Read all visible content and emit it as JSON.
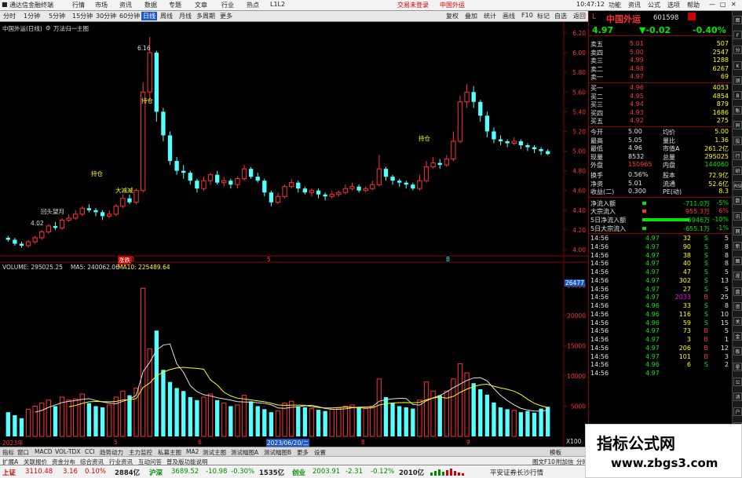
{
  "titlebar": {
    "app_name": "通达信金融终端",
    "menus": [
      "行情",
      "市场",
      "资讯",
      "数据",
      "专题",
      "文章",
      "行业",
      "热点",
      "L1L2"
    ],
    "alert1": "交易未登录",
    "alert2": "中国外运",
    "time": "10:47:12",
    "right_items": [
      "功能",
      "资讯",
      "公式",
      "选项",
      "帮助"
    ]
  },
  "toolbar": {
    "periods": [
      "分时",
      "1分钟",
      "5分钟",
      "15分钟",
      "30分钟",
      "60分钟",
      "日线",
      "周线",
      "月线",
      "多周期",
      "更多"
    ],
    "active_period": "日线",
    "right_buttons": [
      "复权",
      "叠加",
      "统计",
      "画线",
      "F10",
      "标记",
      "自选",
      "返回"
    ]
  },
  "chart": {
    "main_title": "中国外运(日线)",
    "main_indicator": "万法归一主图",
    "price_labels": [
      "6.20",
      "6.00",
      "5.80",
      "5.60",
      "5.40",
      "5.20",
      "5.00",
      "4.80",
      "4.60",
      "4.40",
      "4.20",
      "4.00"
    ],
    "annotations": {
      "high": "6.16",
      "low": "4.02",
      "hold1": "持仓",
      "hold2": "持仓",
      "hold3": "持仓",
      "big_hold": "大减减",
      "cautious": "回头望月"
    },
    "volume_title": "VOLUME: 295025.25",
    "ma5": "MA5: 240062.06",
    "ma10": "MA10: 225489.64",
    "volume_labels": [
      "25000",
      "20000",
      "15000",
      "10000",
      "5000"
    ],
    "vol_unit": "X100",
    "vol_marker": "26477",
    "date_label": "2023/06/20/二",
    "year_label": "2023年",
    "x_marks": [
      "5",
      "6",
      "7",
      "8",
      "9"
    ],
    "mid_marks": [
      "涨跌",
      "B",
      "B"
    ],
    "mid_labels": [
      "5",
      "8"
    ]
  },
  "chart_data": {
    "type": "candlestick",
    "title": "中国外运(日线)",
    "ylim": [
      4.0,
      6.2
    ],
    "volume_ylim": [
      0,
      27000
    ],
    "note": "Approximate daily candles read from chart",
    "candles": [
      [
        4.12,
        4.1,
        4.14,
        4.08
      ],
      [
        4.1,
        4.06,
        4.12,
        4.04
      ],
      [
        4.06,
        4.04,
        4.08,
        4.02
      ],
      [
        4.04,
        4.08,
        4.1,
        4.02
      ],
      [
        4.08,
        4.12,
        4.14,
        4.06
      ],
      [
        4.12,
        4.18,
        4.2,
        4.1
      ],
      [
        4.18,
        4.24,
        4.26,
        4.16
      ],
      [
        4.24,
        4.22,
        4.28,
        4.2
      ],
      [
        4.22,
        4.3,
        4.32,
        4.2
      ],
      [
        4.3,
        4.32,
        4.36,
        4.28
      ],
      [
        4.32,
        4.36,
        4.4,
        4.3
      ],
      [
        4.36,
        4.42,
        4.44,
        4.34
      ],
      [
        4.42,
        4.4,
        4.46,
        4.38
      ],
      [
        4.4,
        4.38,
        4.42,
        4.34
      ],
      [
        4.38,
        4.34,
        4.4,
        4.3
      ],
      [
        4.34,
        4.36,
        4.4,
        4.32
      ],
      [
        4.36,
        4.44,
        4.46,
        4.34
      ],
      [
        4.44,
        4.52,
        4.56,
        4.42
      ],
      [
        4.52,
        4.48,
        4.56,
        4.46
      ],
      [
        4.48,
        4.6,
        4.62,
        4.46
      ],
      [
        4.6,
        5.6,
        5.7,
        4.58
      ],
      [
        5.6,
        6.0,
        6.16,
        5.5
      ],
      [
        6.0,
        5.4,
        6.02,
        5.3
      ],
      [
        5.4,
        5.16,
        5.44,
        5.1
      ],
      [
        5.16,
        4.9,
        5.2,
        4.86
      ],
      [
        4.9,
        4.8,
        4.94,
        4.76
      ],
      [
        4.8,
        4.78,
        4.86,
        4.72
      ],
      [
        4.78,
        4.7,
        4.8,
        4.66
      ],
      [
        4.7,
        4.62,
        4.72,
        4.58
      ],
      [
        4.62,
        4.7,
        4.74,
        4.6
      ],
      [
        4.7,
        4.76,
        4.78,
        4.66
      ],
      [
        4.76,
        4.68,
        4.8,
        4.66
      ],
      [
        4.68,
        4.7,
        4.74,
        4.64
      ],
      [
        4.7,
        4.66,
        4.72,
        4.62
      ],
      [
        4.66,
        4.72,
        4.74,
        4.62
      ],
      [
        4.72,
        4.82,
        4.86,
        4.7
      ],
      [
        4.82,
        4.74,
        4.84,
        4.72
      ],
      [
        4.74,
        4.7,
        4.78,
        4.68
      ],
      [
        4.7,
        4.58,
        4.72,
        4.54
      ],
      [
        4.58,
        4.48,
        4.6,
        4.44
      ],
      [
        4.48,
        4.54,
        4.58,
        4.46
      ],
      [
        4.54,
        4.64,
        4.66,
        4.52
      ],
      [
        4.64,
        4.68,
        4.72,
        4.62
      ],
      [
        4.68,
        4.62,
        4.7,
        4.58
      ],
      [
        4.62,
        4.58,
        4.64,
        4.56
      ],
      [
        4.58,
        4.6,
        4.62,
        4.54
      ],
      [
        4.6,
        4.56,
        4.62,
        4.52
      ],
      [
        4.56,
        4.54,
        4.58,
        4.5
      ],
      [
        4.54,
        4.56,
        4.6,
        4.52
      ],
      [
        4.56,
        4.58,
        4.6,
        4.54
      ],
      [
        4.58,
        4.62,
        4.66,
        4.56
      ],
      [
        4.62,
        4.64,
        4.68,
        4.6
      ],
      [
        4.64,
        4.6,
        4.66,
        4.58
      ],
      [
        4.6,
        4.62,
        4.64,
        4.58
      ],
      [
        4.62,
        4.66,
        4.7,
        4.6
      ],
      [
        4.66,
        4.82,
        4.96,
        4.64
      ],
      [
        4.82,
        4.74,
        4.84,
        4.7
      ],
      [
        4.74,
        4.7,
        4.76,
        4.66
      ],
      [
        4.7,
        4.68,
        4.72,
        4.64
      ],
      [
        4.68,
        4.66,
        4.7,
        4.62
      ],
      [
        4.66,
        4.62,
        4.68,
        4.6
      ],
      [
        4.62,
        4.7,
        4.76,
        4.6
      ],
      [
        4.7,
        4.84,
        4.9,
        4.68
      ],
      [
        4.84,
        4.88,
        4.94,
        4.82
      ],
      [
        4.88,
        4.86,
        4.92,
        4.82
      ],
      [
        4.86,
        4.92,
        4.96,
        4.84
      ],
      [
        4.92,
        5.1,
        5.2,
        4.9
      ],
      [
        5.1,
        5.5,
        5.56,
        5.08
      ],
      [
        5.5,
        5.6,
        5.68,
        5.44
      ],
      [
        5.6,
        5.5,
        5.66,
        5.44
      ],
      [
        5.5,
        5.36,
        5.52,
        5.3
      ],
      [
        5.36,
        5.2,
        5.4,
        5.14
      ],
      [
        5.2,
        5.12,
        5.24,
        5.08
      ],
      [
        5.12,
        5.1,
        5.16,
        5.06
      ],
      [
        5.1,
        5.08,
        5.12,
        5.04
      ],
      [
        5.08,
        5.1,
        5.14,
        5.06
      ],
      [
        5.1,
        5.06,
        5.12,
        5.02
      ],
      [
        5.06,
        5.04,
        5.08,
        5.0
      ],
      [
        5.04,
        5.02,
        5.06,
        4.98
      ],
      [
        5.02,
        5.0,
        5.04,
        4.96
      ],
      [
        5.0,
        4.97,
        5.02,
        4.96
      ]
    ],
    "volumes": [
      4000,
      3500,
      3000,
      4500,
      5000,
      5500,
      6000,
      5000,
      6500,
      6000,
      6200,
      7000,
      5500,
      5000,
      4800,
      5200,
      6500,
      7500,
      6800,
      8000,
      24500,
      14500,
      17500,
      11000,
      9000,
      8000,
      7500,
      6500,
      6000,
      6500,
      7000,
      6000,
      5500,
      5000,
      5200,
      6800,
      5800,
      5000,
      4500,
      4000,
      4200,
      5500,
      5800,
      5000,
      4800,
      4600,
      4400,
      4200,
      4500,
      4700,
      5000,
      5200,
      4800,
      4600,
      5000,
      9500,
      6500,
      5500,
      5000,
      4800,
      4600,
      6000,
      9000,
      7500,
      6800,
      7500,
      9500,
      12000,
      10500,
      8800,
      7800,
      6900,
      5600,
      4800,
      4500,
      4300,
      4000,
      4200,
      3900,
      4600,
      4900
    ]
  },
  "quote": {
    "code_icon": "L",
    "name": "中国外运",
    "code": "601598",
    "price": "4.97",
    "change": "▼-0.02",
    "pct": "-0.40%",
    "asks": [
      {
        "label": "卖五",
        "price": "5.01",
        "vol": "507"
      },
      {
        "label": "卖四",
        "price": "5.00",
        "vol": "2547"
      },
      {
        "label": "卖三",
        "price": "4.99",
        "vol": "1288"
      },
      {
        "label": "卖二",
        "price": "4.98",
        "vol": "6267"
      },
      {
        "label": "卖一",
        "price": "4.97",
        "vol": "69"
      }
    ],
    "bids": [
      {
        "label": "买一",
        "price": "4.96",
        "vol": "4053"
      },
      {
        "label": "买二",
        "price": "4.95",
        "vol": "4854"
      },
      {
        "label": "买三",
        "price": "4.94",
        "vol": "879"
      },
      {
        "label": "买四",
        "price": "4.93",
        "vol": "1686"
      },
      {
        "label": "买五",
        "price": "4.92",
        "vol": "275"
      }
    ],
    "stats": [
      {
        "k1": "今开",
        "v1": "5.00",
        "k2": "均价",
        "v2": "5.00"
      },
      {
        "k1": "最高",
        "v1": "5.05",
        "k2": "量比",
        "v2": "1.36"
      },
      {
        "k1": "最低",
        "v1": "4.96",
        "k2": "市值A",
        "v2": "261.2亿"
      },
      {
        "k1": "现量",
        "v1": "8532",
        "k2": "总量",
        "v2": "295025"
      },
      {
        "k1": "外盘",
        "v1": "150965",
        "k2": "内盘",
        "v2": "144060"
      },
      {
        "k1": "换手",
        "v1": "0.56%",
        "k2": "股本",
        "v2": "72.9亿"
      },
      {
        "k1": "净资",
        "v1": "5.01",
        "k2": "流通",
        "v2": "52.6亿"
      },
      {
        "k1": "收益(二)",
        "v1": "0.300",
        "k2": "PE(动)",
        "v2": "8.3"
      }
    ],
    "flows": [
      {
        "label": "净流入额",
        "value": "-711.0万",
        "pct": "-5%"
      },
      {
        "label": "大宗流入",
        "value": "955.3万",
        "pct": "6%"
      },
      {
        "label": "5日净流入额",
        "value": "-5946万",
        "pct": "-10%"
      },
      {
        "label": "5日大宗流入",
        "value": "-655.1万",
        "pct": "-1%"
      }
    ],
    "ticks": [
      {
        "t": "14:56",
        "p": "4.97",
        "v": "32",
        "bs": "S",
        "n": "5"
      },
      {
        "t": "14:56",
        "p": "4.97",
        "v": "90",
        "bs": "S",
        "n": "8"
      },
      {
        "t": "14:56",
        "p": "4.97",
        "v": "38",
        "bs": "S",
        "n": "8"
      },
      {
        "t": "14:56",
        "p": "4.97",
        "v": "40",
        "bs": "S",
        "n": "8"
      },
      {
        "t": "14:56",
        "p": "4.97",
        "v": "47",
        "bs": "S",
        "n": "5"
      },
      {
        "t": "14:56",
        "p": "4.97",
        "v": "302",
        "bs": "S",
        "n": "13"
      },
      {
        "t": "14:56",
        "p": "4.97",
        "v": "27",
        "bs": "S",
        "n": "5"
      },
      {
        "t": "14:56",
        "p": "4.97",
        "v": "2033",
        "bs": "B",
        "n": "25"
      },
      {
        "t": "14:56",
        "p": "4.96",
        "v": "33",
        "bs": "S",
        "n": "8"
      },
      {
        "t": "14:56",
        "p": "4.96",
        "v": "116",
        "bs": "S",
        "n": "10"
      },
      {
        "t": "14:56",
        "p": "4.96",
        "v": "59",
        "bs": "S",
        "n": "15"
      },
      {
        "t": "14:56",
        "p": "4.97",
        "v": "73",
        "bs": "B",
        "n": "5"
      },
      {
        "t": "14:56",
        "p": "4.97",
        "v": "3",
        "bs": "B",
        "n": "1"
      },
      {
        "t": "14:56",
        "p": "4.97",
        "v": "206",
        "bs": "B",
        "n": "12"
      },
      {
        "t": "14:56",
        "p": "4.97",
        "v": "101",
        "bs": "B",
        "n": "3"
      },
      {
        "t": "14:56",
        "p": "4.96",
        "v": "6",
        "bs": "S",
        "n": "2"
      },
      {
        "t": "14:56",
        "p": "4.97",
        "v": "",
        "bs": "",
        "n": ""
      }
    ],
    "sidetabs": [
      "日线"
    ]
  },
  "tabs": {
    "row1": [
      "指标",
      "窗口",
      "MACD",
      "VOL-TDX",
      "CCI",
      "趋势动力",
      "主力监控",
      "私募主图",
      "MA2",
      "测试主图",
      "测试幅图A",
      "测试幅图B",
      "更多",
      "设置"
    ],
    "row1_right": "模板",
    "row2": [
      "扩展A",
      "关联报价",
      "资金分布",
      "综合资讯",
      "行业资讯",
      "互动问答",
      "普及版功能说明"
    ],
    "row2_right": [
      "图文F10",
      "附加信",
      "分时"
    ]
  },
  "status": {
    "sh_label": "上证",
    "sh_val": "3110.48",
    "sh_chg": "3.16",
    "sh_pct": "0.10%",
    "sh_amt": "2884亿",
    "sz_label": "沪深",
    "sz_val": "3689.52",
    "sz_chg": "-10.98",
    "sz_pct": "-0.30%",
    "sz_amt": "1535亿",
    "cy_label": "创业",
    "cy_val": "2003.91",
    "cy_chg": "-2.31",
    "cy_pct": "-0.12%",
    "cy_amt": "2010亿",
    "broker": "平安证券长沙行情"
  },
  "watermark": {
    "line1": "指标公式网",
    "line2": "www.zbgs3.com"
  },
  "iconstrip": [
    "图",
    "F",
    "分",
    "K",
    "测",
    "B",
    "账",
    "同",
    "投",
    "行",
    "研",
    "RSI",
    "数",
    "讯",
    "网",
    "新",
    "图",
    "视",
    "盘",
    "资",
    "关",
    "金",
    "板",
    "星",
    "公",
    "消",
    "户",
    "文"
  ]
}
